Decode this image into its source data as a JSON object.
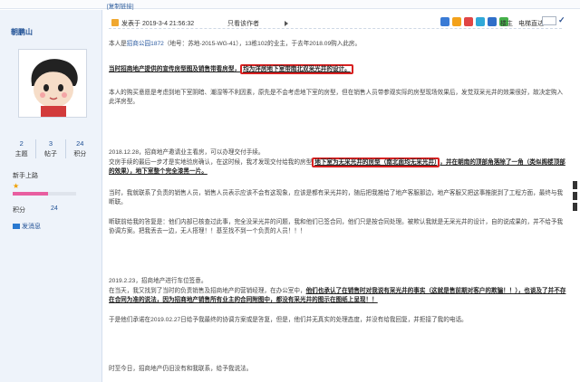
{
  "top": {
    "copy_link": "[复制链接]"
  },
  "user": {
    "name": "朝鹏山",
    "stats": [
      {
        "num": "2",
        "label": "主题"
      },
      {
        "num": "3",
        "label": "帖子"
      },
      {
        "num": "24",
        "label": "积分"
      }
    ],
    "rank": "新手上路",
    "progress_fraction": 0.55,
    "score_label": "积分",
    "score_value": "24",
    "send_message": "发消息"
  },
  "post_header": {
    "time": "发表于 2019-3-4 21:56:32",
    "author_only": "只看该作者",
    "floor": "楼主",
    "goto_label": "电梯直达",
    "share_icon_colors": [
      "#3a7bd5",
      "#f3a21b",
      "#e04545",
      "#2fa8d8",
      "#2f6fc9",
      "#45b04a"
    ]
  },
  "post": {
    "p1_a": "本人是",
    "p1_link": "招商公园1872",
    "p1_b": "（地号：苏地-2015-WG-41），13栋102的业主，于去年2018.09购入此房。",
    "p2_a": "当时招商地产提供的宣传房型图及销售带看房型，",
    "p2_box": "均为洋房地下室带南北双采光井的设计。",
    "p3": "本人的购买意愿是考虑到地下室阴暗、潮湿等不利因素，原先是不会考虑地下室的房型，但在销售人员带参观实际的房型现场效果后，发觉双采光井的效果很好，故决定购入此洋房型。",
    "p4": "2018.12.28，招商地产邀请业主看房，可以办理交付手续。",
    "p5_a": "交房手续的最后一步才是实地验房确认，在这时候，我才发现交付给我的房型",
    "p5_box": "地下室为无采光井的房型（南北面均无采光井）",
    "p5_b": "，并在朝南的顶部角落除了一角（类似阁楼顶部的效果），地下室整个完全漆黑一片。",
    "p6": "当时，我就联系了负责的销售人员，销售人员表示应该不会有这现象，应该是都有采光井的，随后把我推给了地产客服那边，地产客服又把这事推脱到了工程方面，最终与我断联。",
    "p7": "断联前给我的答复是：他们内部已核查过此事，完全没采光井的问题，我和他们已签合同，他们只是按合同处理。被欺认我就是无采光井的设计，自的说成果的，并不给予我协调方案。把我丢去一边，无人搭理！！基至找不到一个负责的人员！！！",
    "p8": "2019.2.23，招商地产进行车位签意。",
    "p9_a": "在当天，我又找到了当时的负责销售及招商地产的营销经理，在办公室中，",
    "p9_b": "他们也承认了在销售时对我说有采光井的事实（这就是售前期对客户的欺骗！！），也谈及了并不存在合同为准的说法，因为招商地产销售所有业主的合同附图中，都没有采光井的图示在图纸上呈现！！",
    "p10": "于是他们承诺在2019.02.27日给予我最终的协调方案或是答复，但是，他们并无真实的处理态度，并没有给我回复，并拒接了我的电话。",
    "p11": "时至今日，招商地产仍旧没有和我联系，给予我说法。"
  }
}
